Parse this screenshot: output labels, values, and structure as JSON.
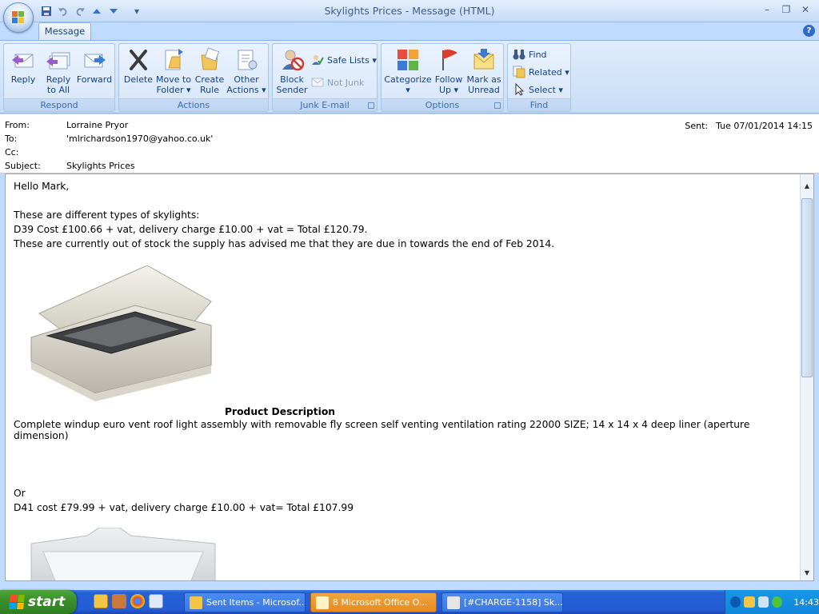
{
  "window": {
    "title": "Skylights Prices - Message (HTML)",
    "minimize": "–",
    "restore": "❐",
    "close": "✕"
  },
  "qat": {
    "more": "▾"
  },
  "tabs": {
    "message": "Message",
    "help": "?"
  },
  "ribbon": {
    "respond": {
      "label": "Respond",
      "reply": "Reply",
      "reply_all_1": "Reply",
      "reply_all_2": "to All",
      "forward": "Forward"
    },
    "actions": {
      "label": "Actions",
      "delete": "Delete",
      "move_1": "Move to",
      "move_2": "Folder ▾",
      "create_1": "Create",
      "create_2": "Rule",
      "other_1": "Other",
      "other_2": "Actions ▾"
    },
    "junk": {
      "label": "Junk E-mail",
      "block_1": "Block",
      "block_2": "Sender",
      "safe_lists": "Safe Lists ▾",
      "not_junk": "Not Junk"
    },
    "options": {
      "label": "Options",
      "categorize_1": "Categorize",
      "categorize_2": "▾",
      "follow_1": "Follow",
      "follow_2": "Up ▾",
      "mark_1": "Mark as",
      "mark_2": "Unread"
    },
    "find": {
      "label": "Find",
      "find": "Find",
      "related": "Related ▾",
      "select": "Select ▾"
    }
  },
  "headers": {
    "from_label": "From:",
    "from_value": "Lorraine Pryor",
    "to_label": "To:",
    "to_value": "'mlrichardson1970@yahoo.co.uk'",
    "cc_label": "Cc:",
    "cc_value": "",
    "subject_label": "Subject:",
    "subject_value": "Skylights Prices",
    "sent_label": "Sent:",
    "sent_value": "Tue 07/01/2014 14:15"
  },
  "body": {
    "greeting": "Hello Mark,",
    "intro": "These are different types of skylights:",
    "d39": "D39 Cost £100.66 + vat, delivery charge £10.00 + vat  = Total £120.79.",
    "stock": "These are currently out of stock the supply has advised me that they are due in towards the end of Feb 2014.",
    "product_desc_heading": "Product Description",
    "product_desc": "Complete windup euro vent roof light assembly with removable fly screen self venting ventilation rating 22000 SIZE; 14 x 14 x 4 deep liner (aperture dimension)",
    "or": "Or",
    "d41": "D41 cost £79.99 + vat, delivery charge £10.00 + vat= Total £107.99"
  },
  "taskbar": {
    "start": "start",
    "tasks": [
      "Sent Items - Microsof...",
      "8 Microsoft Office O...",
      "[#CHARGE-1158] Sk..."
    ],
    "time": "14:43"
  },
  "icons": {
    "office": "office-button-icon",
    "save": "save-icon",
    "undo": "undo-icon",
    "redo": "redo-icon",
    "up": "previous-item-icon",
    "down": "next-item-icon"
  },
  "colors": {
    "ribbon": "#d1e3f9",
    "taskbar": "#245ed6",
    "start": "#3a8f2a",
    "active_task": "#e98b1f"
  }
}
